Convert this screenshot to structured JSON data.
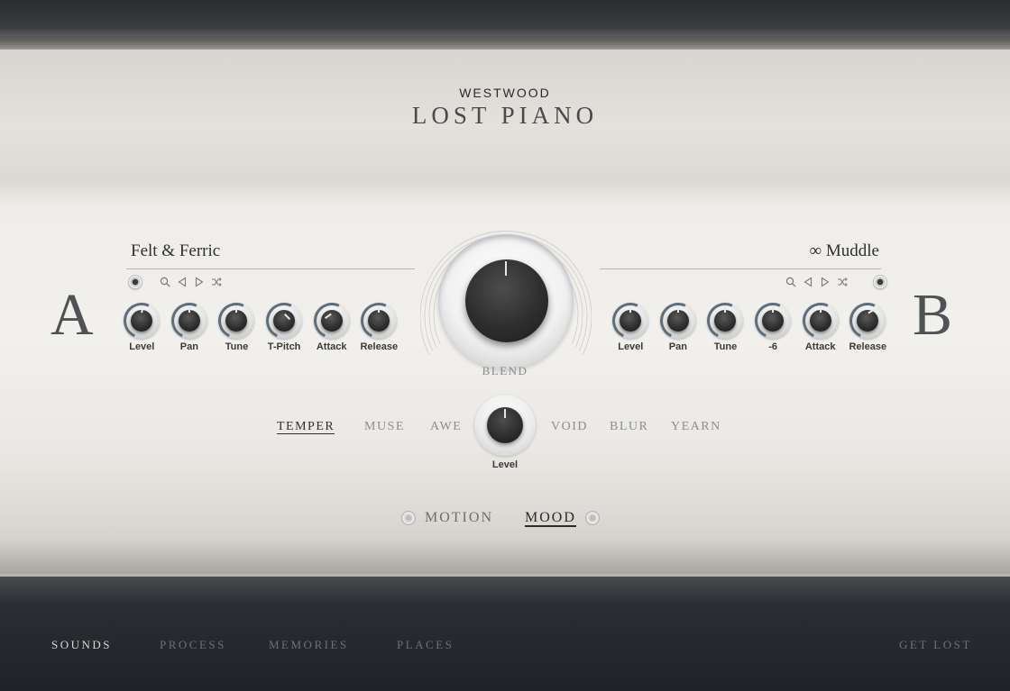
{
  "header": {
    "brand": "WESTWOOD",
    "product": "LOST PIANO"
  },
  "layer_a": {
    "letter": "A",
    "preset_name": "Felt & Ferric",
    "icons": [
      "power-radio-icon",
      "search-icon",
      "previous-icon",
      "next-icon",
      "shuffle-icon"
    ],
    "knobs": [
      {
        "label": "Level",
        "value_deg": 10
      },
      {
        "label": "Pan",
        "value_deg": 0
      },
      {
        "label": "Tune",
        "value_deg": 0
      },
      {
        "label": "T-Pitch",
        "value_deg": 135
      },
      {
        "label": "Attack",
        "value_deg": -125
      },
      {
        "label": "Release",
        "value_deg": 0
      }
    ]
  },
  "layer_b": {
    "letter": "B",
    "preset_name": "∞ Muddle",
    "icons": [
      "search-icon",
      "previous-icon",
      "next-icon",
      "shuffle-icon",
      "power-radio-icon"
    ],
    "knobs": [
      {
        "label": "Level",
        "value_deg": 0
      },
      {
        "label": "Pan",
        "value_deg": 0
      },
      {
        "label": "Tune",
        "value_deg": 0
      },
      {
        "label": "-6",
        "value_deg": 0
      },
      {
        "label": "Attack",
        "value_deg": 0
      },
      {
        "label": "Release",
        "value_deg": 60
      }
    ]
  },
  "blend": {
    "label": "BLEND",
    "value_deg": 0
  },
  "mood_selector": {
    "left": [
      {
        "label": "TEMPER",
        "active": true
      },
      {
        "label": "MUSE",
        "active": false
      },
      {
        "label": "AWE",
        "active": false
      }
    ],
    "right": [
      {
        "label": "VOID",
        "active": false
      },
      {
        "label": "BLUR",
        "active": false
      },
      {
        "label": "YEARN",
        "active": false
      }
    ],
    "level_label": "Level"
  },
  "page_switch": {
    "motion": "MOTION",
    "mood": "MOOD",
    "active": "MOOD"
  },
  "footer_nav": {
    "items": [
      "SOUNDS",
      "PROCESS",
      "MEMORIES",
      "PLACES"
    ],
    "active": "SOUNDS",
    "get_lost": "GET LOST"
  },
  "colors": {
    "accent_dark": "#2a2a2a",
    "inactive_text": "#8d8d8d",
    "arc_blue": "#5d6e7a"
  }
}
